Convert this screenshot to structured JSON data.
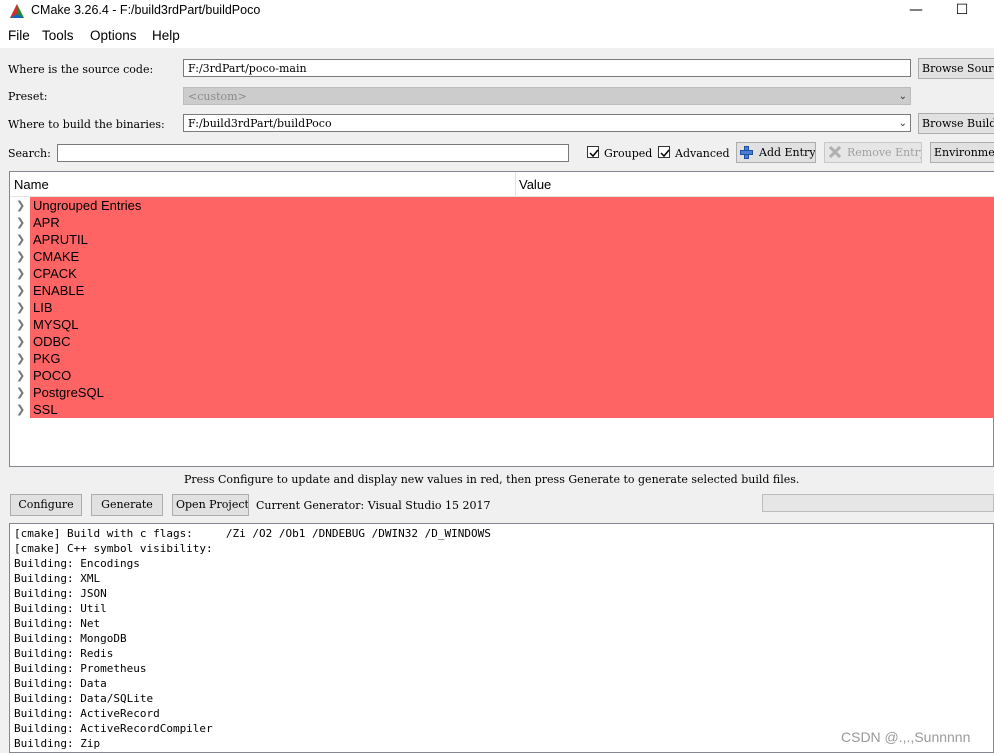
{
  "window": {
    "title": "CMake 3.26.4 - F:/build3rdPart/buildPoco",
    "minimize_glyph": "—",
    "maximize_glyph": "☐"
  },
  "menu": [
    "File",
    "Tools",
    "Options",
    "Help"
  ],
  "source": {
    "label": "Where is the source code:",
    "value": "F:/3rdPart/poco-main",
    "browse_label": "Browse Source..."
  },
  "preset": {
    "label": "Preset:",
    "value": "<custom>"
  },
  "binaries": {
    "label": "Where to build the binaries:",
    "value": "F:/build3rdPart/buildPoco",
    "browse_label": "Browse Build..."
  },
  "search": {
    "label": "Search:",
    "value": "",
    "grouped_label": "Grouped",
    "grouped_checked": true,
    "advanced_label": "Advanced",
    "advanced_checked": true,
    "add_entry_label": "Add Entry",
    "remove_entry_label": "Remove Entry",
    "environment_label": "Environment..."
  },
  "tree": {
    "columns": [
      "Name",
      "Value"
    ],
    "rows": [
      "Ungrouped Entries",
      "APR",
      "APRUTIL",
      "CMAKE",
      "CPACK",
      "ENABLE",
      "LIB",
      "MYSQL",
      "ODBC",
      "PKG",
      "POCO",
      "PostgreSQL",
      "SSL"
    ],
    "new_value_color": "#ff6464"
  },
  "hint_text": "Press Configure to update and display new values in red, then press Generate to generate selected build files.",
  "actions": {
    "configure_label": "Configure",
    "generate_label": "Generate",
    "open_project_label": "Open Project",
    "generator_text": "Current Generator: Visual Studio 15 2017"
  },
  "output_lines": [
    "[cmake] Build with c flags:     /Zi /O2 /Ob1 /DNDEBUG /DWIN32 /D_WINDOWS",
    "[cmake] C++ symbol visibility:",
    "Building: Encodings",
    "Building: XML",
    "Building: JSON",
    "Building: Util",
    "Building: Net",
    "Building: MongoDB",
    "Building: Redis",
    "Building: Prometheus",
    "Building: Data",
    "Building: Data/SQLite",
    "Building: ActiveRecord",
    "Building: ActiveRecordCompiler",
    "Building: Zip"
  ],
  "watermark": "CSDN @.,.,Sunnnnn"
}
